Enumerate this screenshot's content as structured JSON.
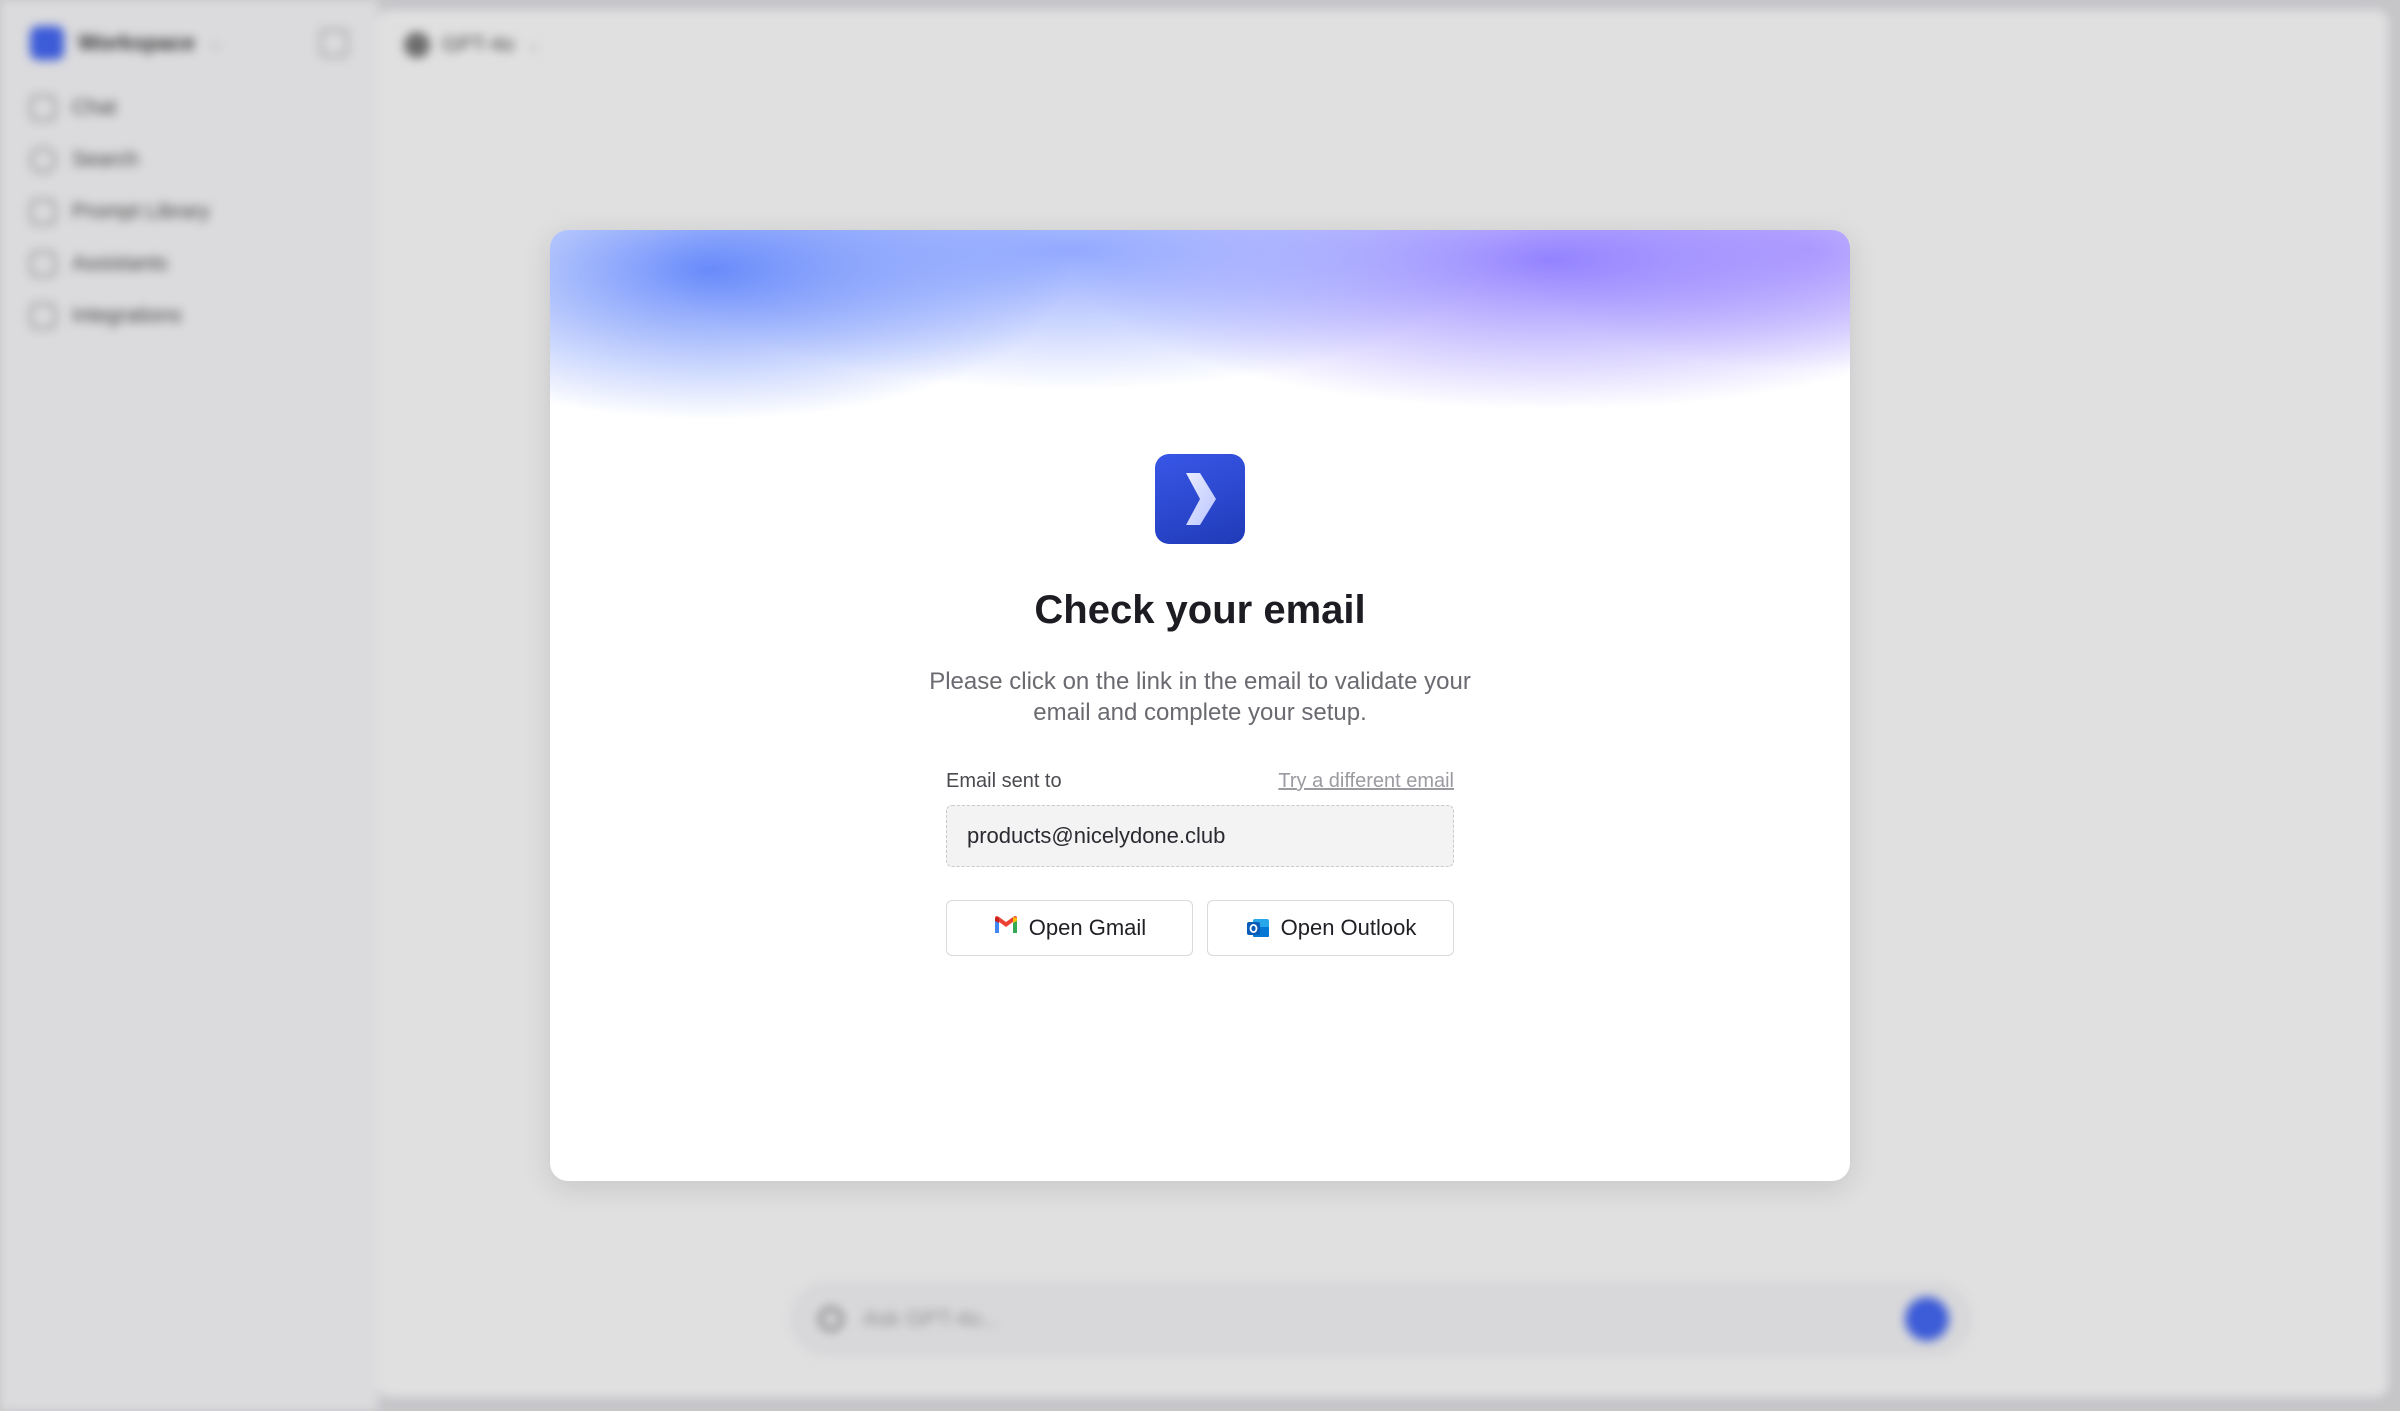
{
  "sidebar": {
    "workspace_name": "Workspace",
    "items": [
      {
        "label": "Chat",
        "icon": "chat-icon"
      },
      {
        "label": "Search",
        "icon": "search-icon"
      },
      {
        "label": "Prompt Library",
        "icon": "library-icon"
      },
      {
        "label": "Assistants",
        "icon": "assistants-icon"
      },
      {
        "label": "Integrations",
        "icon": "integrations-icon"
      }
    ]
  },
  "header": {
    "model_label": "GPT-4o"
  },
  "composer": {
    "placeholder": "Ask GPT-4o..."
  },
  "modal": {
    "title": "Check your email",
    "description": "Please click on the link in the email to validate your email and complete your setup.",
    "field_label": "Email sent to",
    "change_link": "Try a different email",
    "email": "products@nicelydone.club",
    "gmail_button": "Open Gmail",
    "outlook_button": "Open Outlook"
  },
  "colors": {
    "accent": "#3f63f0",
    "logo_gradient_start": "#3957e8",
    "logo_gradient_end": "#1f3bb8",
    "title": "#1c1c22",
    "muted_text": "#6a6a70"
  }
}
